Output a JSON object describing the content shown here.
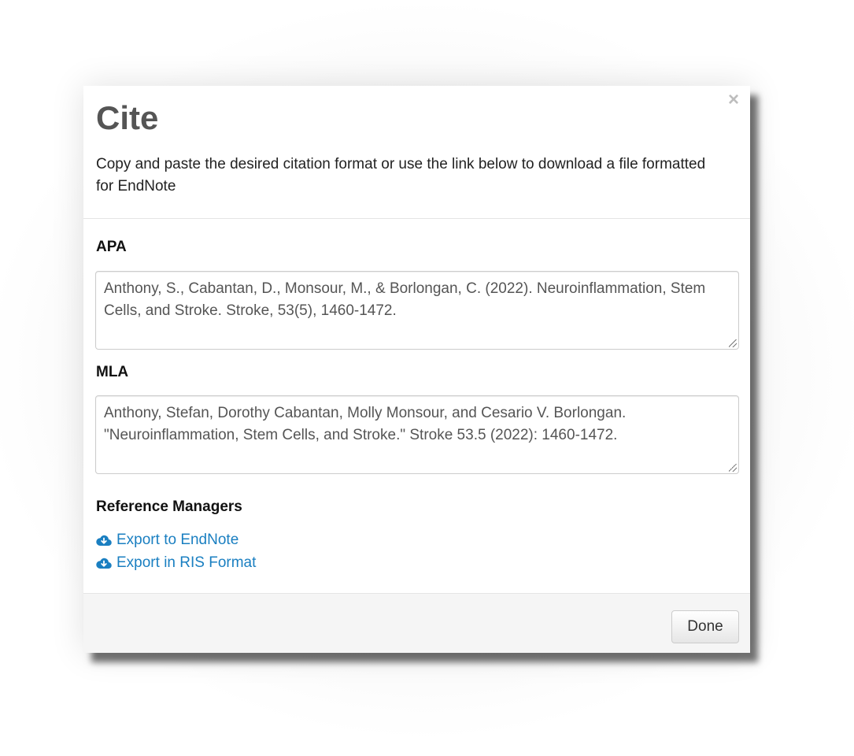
{
  "modal": {
    "title": "Cite",
    "subtitle": "Copy and paste the desired citation format or use the link below to download a file formatted for EndNote",
    "close_label": "×"
  },
  "citations": {
    "apa": {
      "label": "APA",
      "text": "Anthony, S., Cabantan, D., Monsour, M., & Borlongan, C. (2022). Neuroinflammation, Stem Cells, and Stroke. Stroke, 53(5), 1460-1472."
    },
    "mla": {
      "label": "MLA",
      "text": "Anthony, Stefan, Dorothy Cabantan, Molly Monsour, and Cesario V. Borlongan. \"Neuroinflammation, Stem Cells, and Stroke.\" Stroke 53.5 (2022): 1460-1472."
    }
  },
  "reference_managers": {
    "heading": "Reference Managers",
    "links": [
      {
        "label": "Export to EndNote",
        "icon": "cloud-download-icon"
      },
      {
        "label": "Export in RIS Format",
        "icon": "cloud-download-icon"
      }
    ]
  },
  "footer": {
    "done_label": "Done"
  },
  "colors": {
    "link": "#1a7fc1",
    "title": "#555555",
    "footer_bg": "#f5f5f5"
  }
}
